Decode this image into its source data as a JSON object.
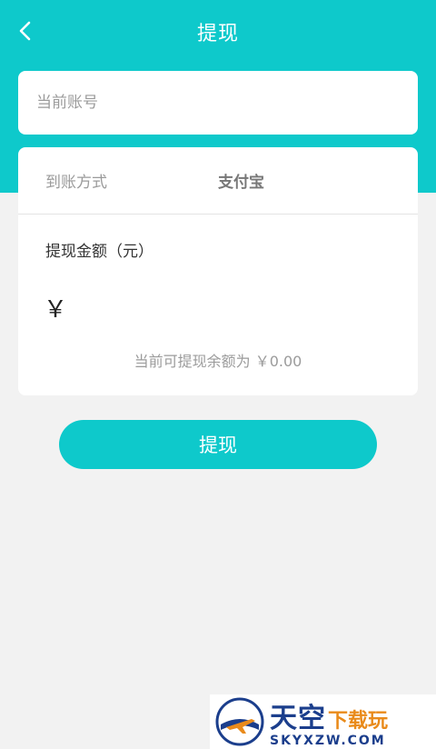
{
  "header": {
    "title": "提现",
    "back_icon": "chevron-left-icon"
  },
  "account": {
    "placeholder": "当前账号",
    "value": ""
  },
  "withdraw": {
    "method_label": "到账方式",
    "method_value": "支付宝",
    "amount_label": "提现金额（元）",
    "currency_symbol": "￥",
    "amount_value": "",
    "balance_text": "当前可提现余额为 ￥0.00"
  },
  "submit": {
    "label": "提现"
  },
  "watermark": {
    "cn_main": "天空",
    "cn_sub": "下载玩",
    "en": "SKYXZW.COM"
  },
  "colors": {
    "accent": "#0ec9cb",
    "background": "#f2f2f2",
    "card": "#ffffff"
  }
}
